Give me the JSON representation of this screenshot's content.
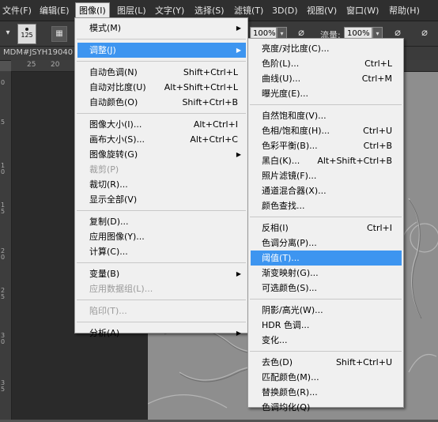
{
  "menubar": [
    "文件(F)",
    "编辑(E)",
    "图像(I)",
    "图层(L)",
    "文字(Y)",
    "选择(S)",
    "滤镜(T)",
    "3D(D)",
    "视图(V)",
    "窗口(W)",
    "帮助(H)"
  ],
  "options": {
    "brush_size": "125",
    "opacity": "100%",
    "flow_label": "流量:",
    "flow": "100%"
  },
  "doc_tab": "MDM#JSYH19040",
  "ruler": {
    "top": [
      "25",
      "20"
    ],
    "left": [
      "0",
      "5",
      "1",
      "0",
      "1",
      "5",
      "2",
      "0",
      "2",
      "5",
      "3",
      "0",
      "3",
      "5"
    ]
  },
  "image_menu": [
    {
      "label": "模式(M)",
      "arrow": true
    },
    {
      "sep": true
    },
    {
      "label": "调整(J)",
      "arrow": true,
      "highlight": true
    },
    {
      "sep": true
    },
    {
      "label": "自动色调(N)",
      "shortcut": "Shift+Ctrl+L"
    },
    {
      "label": "自动对比度(U)",
      "shortcut": "Alt+Shift+Ctrl+L"
    },
    {
      "label": "自动颜色(O)",
      "shortcut": "Shift+Ctrl+B"
    },
    {
      "sep": true
    },
    {
      "label": "图像大小(I)...",
      "shortcut": "Alt+Ctrl+I"
    },
    {
      "label": "画布大小(S)...",
      "shortcut": "Alt+Ctrl+C"
    },
    {
      "label": "图像旋转(G)",
      "arrow": true
    },
    {
      "label": "裁剪(P)",
      "disabled": true
    },
    {
      "label": "裁切(R)..."
    },
    {
      "label": "显示全部(V)"
    },
    {
      "sep": true
    },
    {
      "label": "复制(D)..."
    },
    {
      "label": "应用图像(Y)..."
    },
    {
      "label": "计算(C)..."
    },
    {
      "sep": true
    },
    {
      "label": "变量(B)",
      "arrow": true
    },
    {
      "label": "应用数据组(L)...",
      "disabled": true
    },
    {
      "sep": true
    },
    {
      "label": "陷印(T)...",
      "disabled": true
    },
    {
      "sep": true
    },
    {
      "label": "分析(A)",
      "arrow": true
    }
  ],
  "adjust_menu": [
    {
      "label": "亮度/对比度(C)..."
    },
    {
      "label": "色阶(L)...",
      "shortcut": "Ctrl+L"
    },
    {
      "label": "曲线(U)...",
      "shortcut": "Ctrl+M"
    },
    {
      "label": "曝光度(E)..."
    },
    {
      "sep": true
    },
    {
      "label": "自然饱和度(V)..."
    },
    {
      "label": "色相/饱和度(H)...",
      "shortcut": "Ctrl+U"
    },
    {
      "label": "色彩平衡(B)...",
      "shortcut": "Ctrl+B"
    },
    {
      "label": "黑白(K)...",
      "shortcut": "Alt+Shift+Ctrl+B"
    },
    {
      "label": "照片滤镜(F)..."
    },
    {
      "label": "通道混合器(X)..."
    },
    {
      "label": "颜色查找..."
    },
    {
      "sep": true
    },
    {
      "label": "反相(I)",
      "shortcut": "Ctrl+I"
    },
    {
      "label": "色调分离(P)..."
    },
    {
      "label": "阈值(T)...",
      "highlight": true
    },
    {
      "label": "渐变映射(G)..."
    },
    {
      "label": "可选颜色(S)..."
    },
    {
      "sep": true
    },
    {
      "label": "阴影/高光(W)..."
    },
    {
      "label": "HDR 色调..."
    },
    {
      "label": "变化..."
    },
    {
      "sep": true
    },
    {
      "label": "去色(D)",
      "shortcut": "Shift+Ctrl+U"
    },
    {
      "label": "匹配颜色(M)..."
    },
    {
      "label": "替换颜色(R)..."
    },
    {
      "label": "色调均化(Q)"
    }
  ],
  "colors": {
    "highlight": "#3d95f0",
    "menu_bg": "#f0f0f0",
    "menubar_bg": "#2f2f2f"
  }
}
